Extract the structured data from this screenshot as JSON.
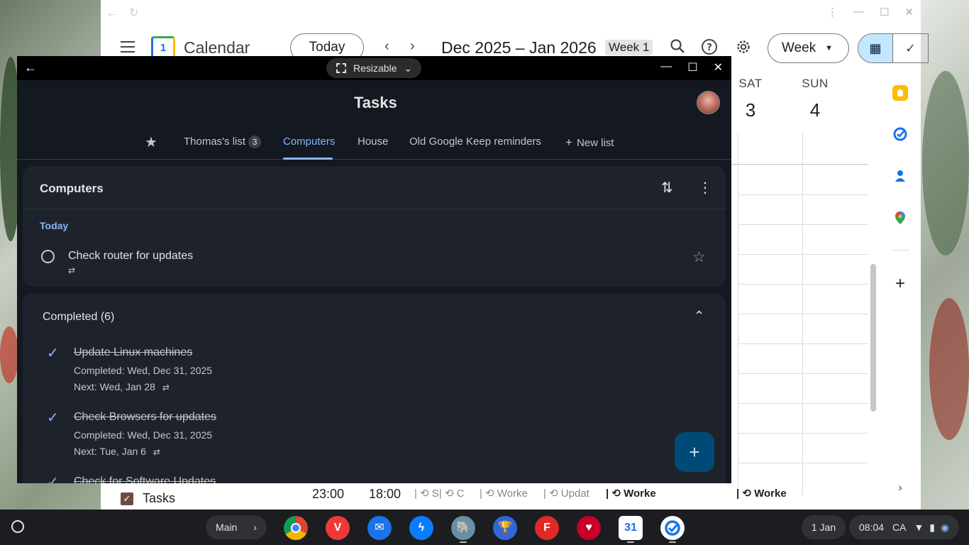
{
  "calendar": {
    "app_name": "Calendar",
    "logo_day": "1",
    "today_label": "Today",
    "prev_label": "‹",
    "next_label": "›",
    "range": "Dec 2025 – Jan 2026",
    "week_badge": "Week 1",
    "view_label": "Week",
    "days": [
      {
        "name": "SAT",
        "date": "3"
      },
      {
        "name": "SUN",
        "date": "4"
      }
    ],
    "bottom_tasks_label": "Tasks",
    "bottom_events": [
      "23:00",
      "18:00",
      "| ⟲ S| ⟲ C",
      "| ⟲ Worke",
      "| ⟲ Updat",
      "| ⟲ Worke",
      "| ⟲ Worke"
    ],
    "side_icons": [
      "keep-icon",
      "tasks-icon",
      "contacts-icon",
      "maps-icon"
    ]
  },
  "tasks": {
    "window_mode": "Resizable",
    "title": "Tasks",
    "tabs": [
      {
        "label": "Thomas's list",
        "count": "3"
      },
      {
        "label": "Computers"
      },
      {
        "label": "House"
      },
      {
        "label": "Old Google Keep reminders"
      },
      {
        "label": "New list"
      }
    ],
    "list_title": "Computers",
    "section_label": "Today",
    "open_task": {
      "title": "Check router for updates"
    },
    "completed_header": "Completed (6)",
    "completed": [
      {
        "title": "Update Linux machines",
        "completed": "Completed: Wed, Dec 31, 2025",
        "next": "Next: Wed, Jan 28"
      },
      {
        "title": "Check Browsers for updates",
        "completed": "Completed: Wed, Dec 31, 2025",
        "next": "Next: Tue, Jan 6"
      },
      {
        "title": "Check for Software Updates"
      }
    ]
  },
  "shelf": {
    "desk_label": "Main",
    "date": "1 Jan",
    "time": "08:04",
    "locale": "CA",
    "apps": [
      {
        "name": "chrome-icon",
        "color": "#db4437"
      },
      {
        "name": "vivaldi-icon",
        "color": "#ef3939"
      },
      {
        "name": "mail-icon",
        "color": "#1a73e8"
      },
      {
        "name": "messenger-icon",
        "color": "#0a7cff"
      },
      {
        "name": "mastodon-icon",
        "color": "#6a8fa3"
      },
      {
        "name": "trophy-icon",
        "color": "#3367d6"
      },
      {
        "name": "flipboard-icon",
        "color": "#e12828"
      },
      {
        "name": "iheart-icon",
        "color": "#c6002b"
      },
      {
        "name": "calendar-app-icon",
        "color": "#ffffff"
      },
      {
        "name": "tasks-app-icon",
        "color": "#ffffff"
      }
    ]
  }
}
